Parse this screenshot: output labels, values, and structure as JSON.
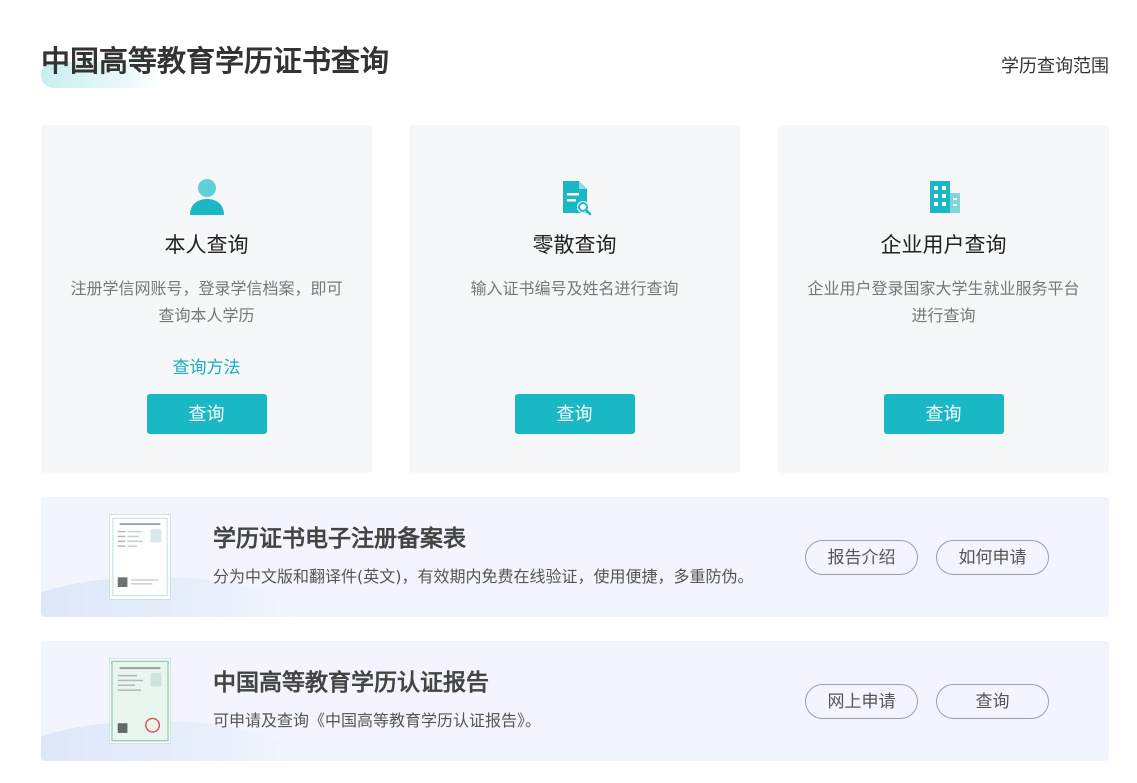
{
  "header": {
    "title": "中国高等教育学历证书查询",
    "scope_link": "学历查询范围"
  },
  "cards": [
    {
      "icon": "person-icon",
      "title": "本人查询",
      "desc": "注册学信网账号，登录学信档案，即可查询本人学历",
      "method_link": "查询方法",
      "button": "查询"
    },
    {
      "icon": "document-search-icon",
      "title": "零散查询",
      "desc": "输入证书编号及姓名进行查询",
      "button": "查询"
    },
    {
      "icon": "building-icon",
      "title": "企业用户查询",
      "desc": "企业用户登录国家大学生就业服务平台进行查询",
      "button": "查询"
    }
  ],
  "banners": [
    {
      "title": "学历证书电子注册备案表",
      "desc": "分为中文版和翻译件(英文)，有效期内免费在线验证，使用便捷，多重防伪。",
      "buttons": [
        "报告介绍",
        "如何申请"
      ]
    },
    {
      "title": "中国高等教育学历认证报告",
      "desc": "可申请及查询《中国高等教育学历认证报告》。",
      "buttons": [
        "网上申请",
        "查询"
      ]
    }
  ],
  "colors": {
    "accent": "#1ab8c5",
    "link": "#18aebd",
    "card_bg": "#f5f7f8",
    "banner_bg": "#f2f5fd"
  }
}
